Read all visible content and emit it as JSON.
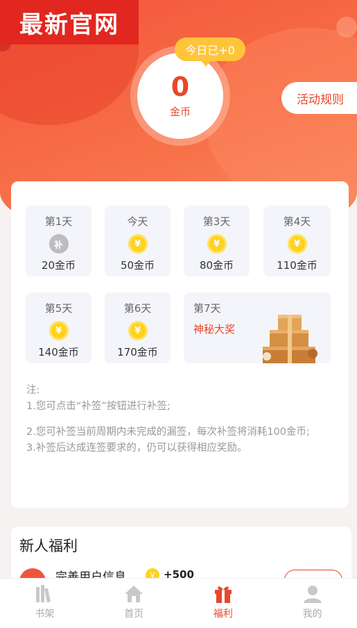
{
  "watermark": "最新官网",
  "coins": {
    "today_badge": "今日已+0",
    "count": "0",
    "unit": "金币"
  },
  "rules_button": "活动规则",
  "checkin": {
    "days": [
      {
        "title": "第1天",
        "reward": "20金币",
        "icon": "supplement-icon",
        "icon_text": "补"
      },
      {
        "title": "今天",
        "reward": "50金币",
        "icon": "coin-icon",
        "icon_text": "¥"
      },
      {
        "title": "第3天",
        "reward": "80金币",
        "icon": "coin-icon",
        "icon_text": "¥"
      },
      {
        "title": "第4天",
        "reward": "110金币",
        "icon": "coin-icon",
        "icon_text": "¥"
      },
      {
        "title": "第5天",
        "reward": "140金币",
        "icon": "coin-icon",
        "icon_text": "¥"
      },
      {
        "title": "第6天",
        "reward": "170金币",
        "icon": "coin-icon",
        "icon_text": "¥"
      }
    ],
    "day7": {
      "title": "第7天",
      "prize": "神秘大奖",
      "icon": "gift-box-icon"
    },
    "notes": [
      "注:",
      "1.您可点击“补签”按钮进行补签;",
      "2.您可补签当前周期内未完成的漏签，每次补签将消耗100金币;",
      "3.补签后达成连签要求的，仍可以获得相应奖励。"
    ]
  },
  "newbie": {
    "title": "新人福利",
    "task": {
      "name": "完善用户信息",
      "coin_icon": "¥",
      "reward": "+500"
    }
  },
  "tabbar": [
    {
      "label": "书架",
      "icon": "bookshelf-icon",
      "active": false
    },
    {
      "label": "首页",
      "icon": "home-icon",
      "active": false
    },
    {
      "label": "福利",
      "icon": "gift-icon",
      "active": true
    },
    {
      "label": "我的",
      "icon": "user-icon",
      "active": false
    }
  ],
  "colors": {
    "accent": "#e8472c",
    "coin": "#ffd21e",
    "badge": "#ffc53a"
  }
}
